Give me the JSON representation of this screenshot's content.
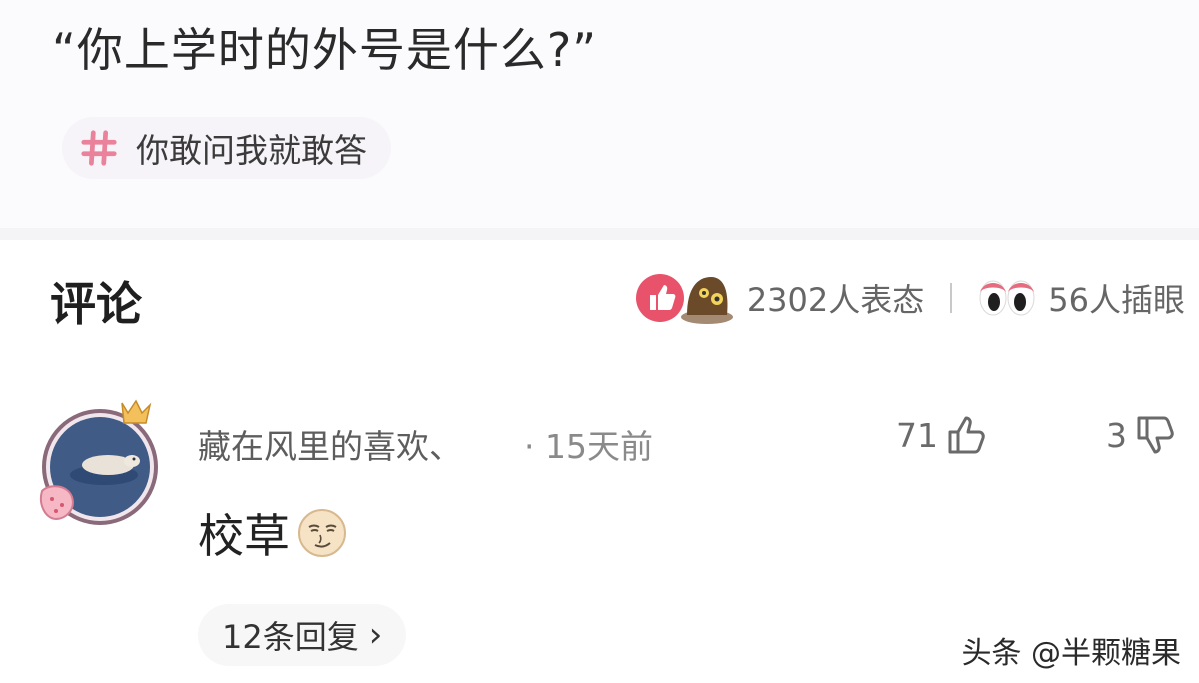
{
  "question": {
    "text": "“你上学时的外号是什么?”"
  },
  "topic": {
    "icon": "hash-icon",
    "label": "你敢问我就敢答",
    "accent": "#e9829a"
  },
  "comments_header": {
    "title": "评论",
    "reaction_count": "2302人表态",
    "peek_count": "56人插眼"
  },
  "comment": {
    "username": "藏在风里的喜欢、",
    "time": "· 15天前",
    "likes": "71",
    "dislikes": "3",
    "text": "校草",
    "emoji": "smirk-face-emoji",
    "replies": "12条回复",
    "replies_chevron": "›"
  },
  "watermark": "头条 @半颗糖果"
}
